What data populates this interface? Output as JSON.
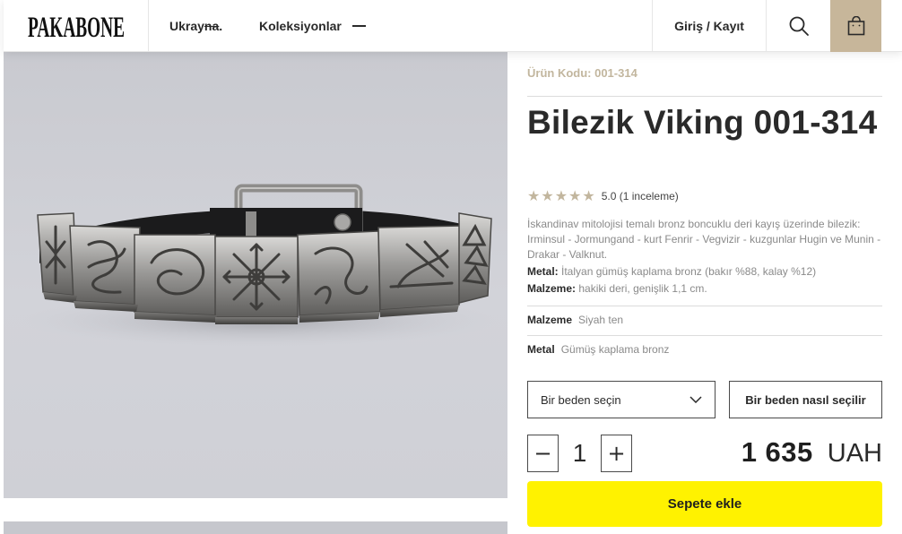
{
  "header": {
    "logo_text": "PAKABONE",
    "country_prefix": "Ukray",
    "country_strike": "na",
    "country_suffix": ".",
    "collections_label": "Koleksiyonlar",
    "login_label": "Giriş / Kayıt",
    "icons": {
      "search": "search-icon",
      "cart": "shopping-bag-icon",
      "menu": "dash-icon"
    },
    "cart_color": "#c7b69a"
  },
  "gallery": {
    "zoom_label": "+",
    "zoom_color": "#fff200"
  },
  "product": {
    "sku": "Ürün Kodu: 001-314",
    "title": "Bilezik Viking 001-314",
    "stars": "★★★★★",
    "rating_text": "5.0 (1 inceleme)",
    "rating_value": 5,
    "description": "İskandinav mitolojisi temalı bronz boncuklu deri kayış üzerinde bilezik: Irminsul - Jormungand - kurt Fenrir - Vegvizir - kuzgunlar Hugin ve Munin - Drakar - Valknut.",
    "metal_label": "Metal:",
    "metal_value": "İtalyan gümüş kaplama bronz (bakır %88, kalay %12)",
    "material_label": "Malzeme:",
    "material_value": "hakiki deri, genişlik 1,1 cm.",
    "attributes": [
      {
        "key": "Malzeme",
        "value": "Siyah ten"
      },
      {
        "key": "Metal",
        "value": "Gümüş kaplama bronz"
      }
    ],
    "size_select_placeholder": "Bir beden seçin",
    "size_guide_label": "Bir beden nasıl seçilir",
    "qty_minus": "−",
    "quantity": "1",
    "qty_plus": "+",
    "price_amount": "1 635",
    "price_currency": "UAH",
    "add_to_cart_label": "Sepete ekle",
    "accent_color": "#c2b69e",
    "cta_color": "#fff200"
  }
}
